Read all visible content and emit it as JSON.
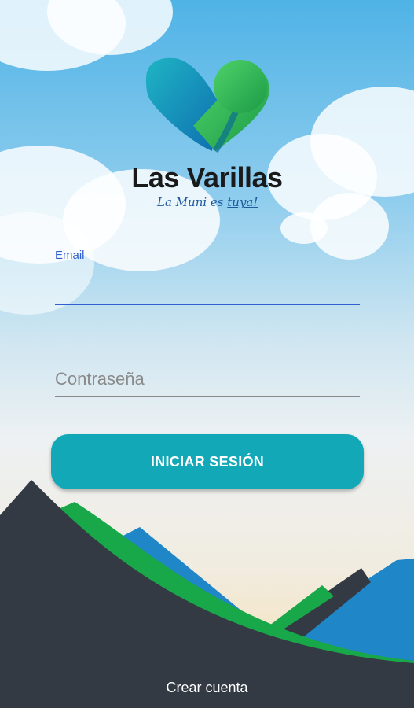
{
  "brand": {
    "name": "Las Varillas",
    "tagline_part1": "La Muni es ",
    "tagline_part2": "tuya!"
  },
  "form": {
    "email_label": "Email",
    "email_value": "",
    "password_placeholder": "Contraseña",
    "password_value": ""
  },
  "actions": {
    "login_label": "INICIAR SESIÓN",
    "create_account_label": "Crear cuenta"
  },
  "colors": {
    "accent_button": "#12a8b7",
    "focus_blue": "#2f5fd0",
    "mountain_dark": "#333a44",
    "mountain_green": "#18a84a",
    "mountain_blue": "#1f86c8"
  }
}
